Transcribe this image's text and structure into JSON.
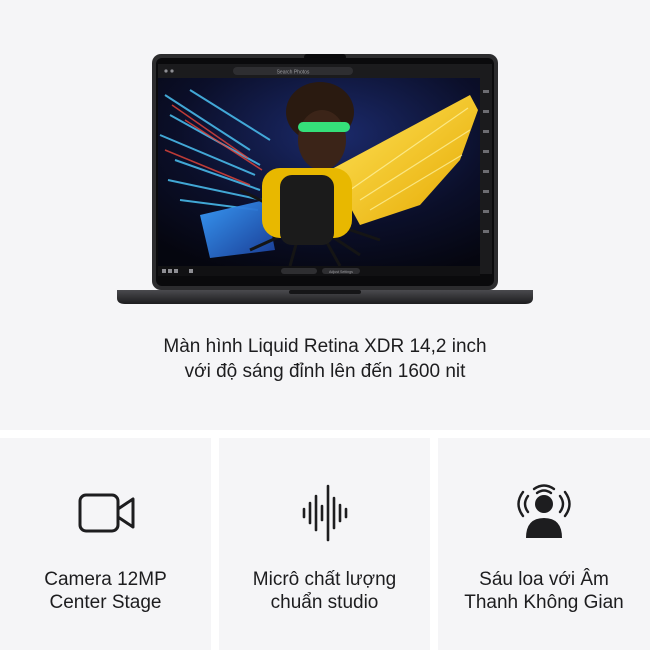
{
  "hero": {
    "caption_line1": "Màn hình Liquid Retina XDR 14,2 inch",
    "caption_line2": "với độ sáng đỉnh lên đến 1600 nit",
    "screen": {
      "search_placeholder": "Search Photos",
      "bottom_label": "Adjust Settings"
    }
  },
  "features": [
    {
      "icon": "video-camera-icon",
      "line1": "Camera 12MP",
      "line2": "Center Stage"
    },
    {
      "icon": "microphone-waveform-icon",
      "line1": "Micrô chất lượng",
      "line2": "chuẩn studio"
    },
    {
      "icon": "spatial-audio-speakers-icon",
      "line1": "Sáu loa với Âm",
      "line2": "Thanh Không Gian"
    }
  ],
  "colors": {
    "tile_background": "#f5f5f7",
    "text": "#1d1d1f",
    "laptop_body": "#2c2c2e",
    "feather_yellow": "#f2c40f",
    "feather_blue": "#2f6fd6"
  }
}
